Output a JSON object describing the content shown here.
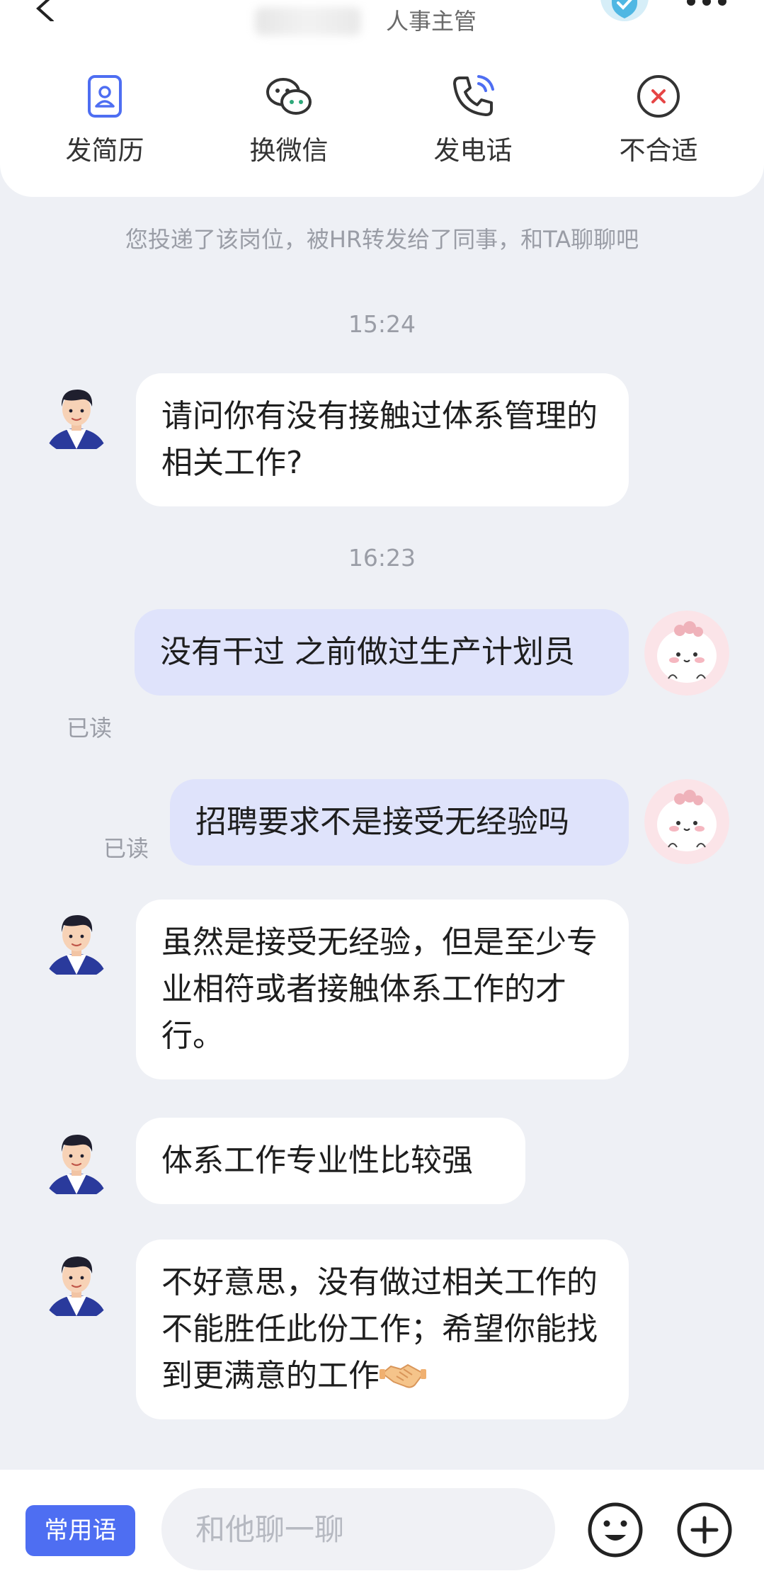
{
  "header": {
    "contact_title": "人事主管",
    "actions": [
      {
        "label": "发简历",
        "icon": "resume-icon"
      },
      {
        "label": "换微信",
        "icon": "wechat-icon"
      },
      {
        "label": "发电话",
        "icon": "phone-icon"
      },
      {
        "label": "不合适",
        "icon": "reject-icon"
      }
    ]
  },
  "notice": "您投递了该岗位，被HR转发给了同事，和TA聊聊吧",
  "timestamps": [
    "15:24",
    "16:23"
  ],
  "messages": [
    {
      "from": "recruiter",
      "text": "请问你有没有接触过体系管理的相关工作?"
    },
    {
      "from": "me",
      "text": "没有干过 之前做过生产计划员",
      "status": "已读"
    },
    {
      "from": "me",
      "text": "招聘要求不是接受无经验吗",
      "status": "已读"
    },
    {
      "from": "recruiter",
      "text": "虽然是接受无经验，但是至少专业相符或者接触体系工作的才行。"
    },
    {
      "from": "recruiter",
      "text": "体系工作专业性比较强"
    },
    {
      "from": "recruiter",
      "text": "不好意思，没有做过相关工作的不能胜任此份工作；希望你能找到更满意的工作",
      "emoji": "handshake"
    }
  ],
  "bottom_bar": {
    "phrases_label": "常用语",
    "input_placeholder": "和他聊一聊",
    "input_value": ""
  },
  "colors": {
    "accent": "#4e6ef2",
    "outgoing_bubble": "#dfe3fb",
    "background": "#eef0f5"
  }
}
